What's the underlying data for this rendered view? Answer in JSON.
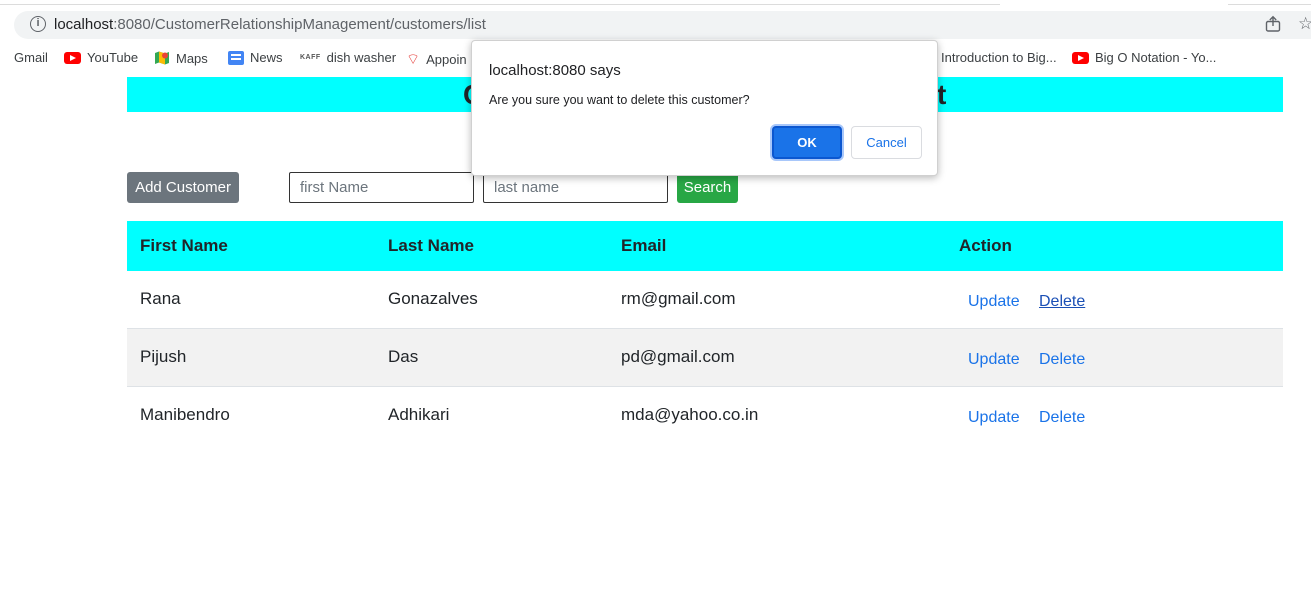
{
  "browser": {
    "url_host": "localhost",
    "url_path": ":8080/CustomerRelationshipManagement/customers/list",
    "bookmarks": [
      {
        "label": "Gmail",
        "icon": "none"
      },
      {
        "label": "YouTube",
        "icon": "youtube-icon"
      },
      {
        "label": "Maps",
        "icon": "maps-icon"
      },
      {
        "label": "News",
        "icon": "news-icon"
      },
      {
        "label": "dish washer",
        "icon": "kaff-icon"
      },
      {
        "label": "Appoin",
        "icon": "wifi-icon"
      },
      {
        "label": "Introduction to Big...",
        "icon": "none"
      },
      {
        "label": "Big O Notation - Yo...",
        "icon": "youtube-icon"
      }
    ],
    "kaff_text": "KAFF"
  },
  "page": {
    "title_left": "C",
    "title_right": "t",
    "add_button": "Add Customer",
    "first_name_placeholder": "first Name",
    "last_name_placeholder": "last name",
    "search_button": "Search"
  },
  "table": {
    "headers": [
      "First Name",
      "Last Name",
      "Email",
      "Action"
    ],
    "rows": [
      {
        "first": "Rana",
        "last": "Gonazalves",
        "email": "rm@gmail.com",
        "update": "Update",
        "delete": "Delete"
      },
      {
        "first": "Pijush",
        "last": "Das",
        "email": "pd@gmail.com",
        "update": "Update",
        "delete": "Delete"
      },
      {
        "first": "Manibendro",
        "last": "Adhikari",
        "email": "mda@yahoo.co.in",
        "update": "Update",
        "delete": "Delete"
      }
    ]
  },
  "dialog": {
    "title": "localhost:8080 says",
    "message": "Are you sure you want to delete this customer?",
    "ok": "OK",
    "cancel": "Cancel"
  },
  "colors": {
    "header_cyan": "#00ffff",
    "add_gray": "#6c757d",
    "search_green": "#28a745",
    "link_blue": "#1a73e8",
    "ok_blue": "#1a73e8"
  }
}
